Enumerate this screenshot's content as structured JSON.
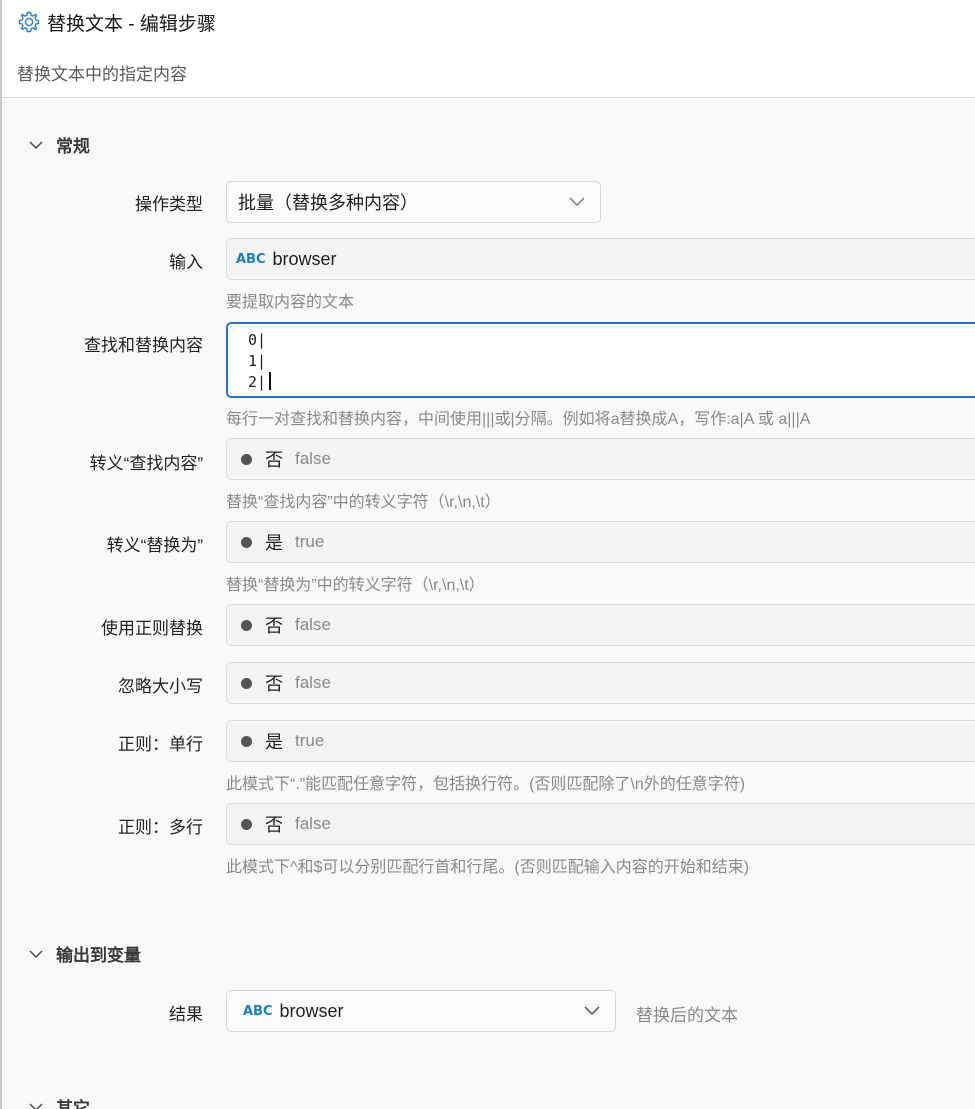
{
  "window": {
    "title": "替换文本  -  编辑步骤",
    "subtitle": "替换文本中的指定内容"
  },
  "sections": {
    "general": "常规",
    "output": "输出到变量",
    "other": "其它"
  },
  "fields": {
    "op_type": {
      "label": "操作类型",
      "value": "批量（替换多种内容）"
    },
    "input": {
      "label": "输入",
      "type_tag": "ABC",
      "value": "browser",
      "hint": "要提取内容的文本"
    },
    "find_replace": {
      "label": "查找和替换内容",
      "lines": [
        "0|",
        "1|",
        "2|"
      ],
      "hint": "每行一对查找和替换内容，中间使用|||或|分隔。例如将a替换成A，写作:a|A 或 a|||A"
    },
    "escape_find": {
      "label": "转义“查找内容”",
      "bool_label": "否",
      "bool_value": "false",
      "hint": "替换“查找内容”中的转义字符（\\r,\\n,\\t）"
    },
    "escape_replace": {
      "label": "转义“替换为”",
      "bool_label": "是",
      "bool_value": "true",
      "hint": "替换“替换为”中的转义字符（\\r,\\n,\\t）"
    },
    "use_regex": {
      "label": "使用正则替换",
      "bool_label": "否",
      "bool_value": "false"
    },
    "ignore_case": {
      "label": "忽略大小写",
      "bool_label": "否",
      "bool_value": "false"
    },
    "regex_singleline": {
      "label": "正则：单行",
      "bool_label": "是",
      "bool_value": "true",
      "hint": "此模式下“.”能匹配任意字符，包括换行符。(否则匹配除了\\n外的任意字符)"
    },
    "regex_multiline": {
      "label": "正则：多行",
      "bool_label": "否",
      "bool_value": "false",
      "hint": "此模式下^和$可以分别匹配行首和行尾。(否则匹配输入内容的开始和结束)"
    },
    "result": {
      "label": "结果",
      "type_tag": "ABC",
      "value": "browser",
      "hint": "替换后的文本"
    }
  },
  "colors": {
    "accent": "#2d6fc1",
    "abc_tag": "#1a7fc1"
  },
  "icons": {
    "title": "gear-icon",
    "section": "chevron-down-icon",
    "dropdown": "chevron-down-icon"
  }
}
